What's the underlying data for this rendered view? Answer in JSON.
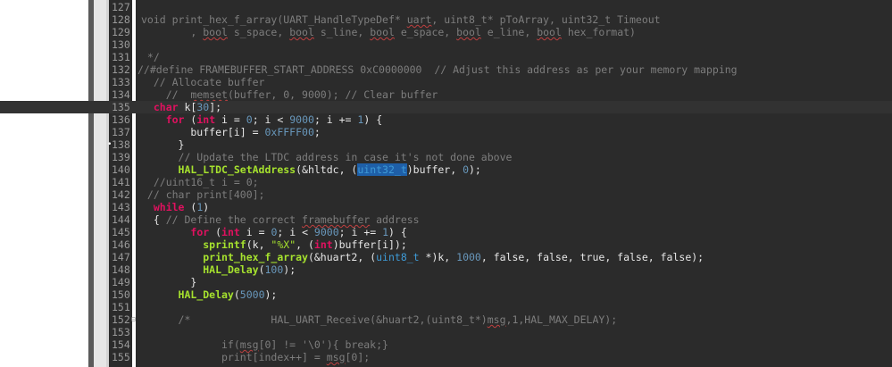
{
  "colors": {
    "editor_background": "#2b2b2b",
    "keyword": "#e0115f",
    "function": "#a6e22e",
    "comment": "#7d7d7d",
    "number": "#6897bb",
    "type": "#3e9ad6",
    "selection": "#1e5fa8",
    "line_number": "#9a9a9a"
  },
  "editor": {
    "lines": [
      {
        "num": "127",
        "tokens": []
      },
      {
        "num": "128",
        "tokens": [
          {
            "t": "void print_hex_f_array(UART_HandleTypeDef* ",
            "c": "comment"
          },
          {
            "t": "uart",
            "c": "spell"
          },
          {
            "t": ", uint8_t* pToArray, uint32_t Timeout",
            "c": "comment"
          }
        ]
      },
      {
        "num": "129",
        "tokens": [
          {
            "t": "        , ",
            "c": "comment"
          },
          {
            "t": "bool",
            "c": "spell"
          },
          {
            "t": " s_space, ",
            "c": "comment"
          },
          {
            "t": "bool",
            "c": "spell"
          },
          {
            "t": " s_line, ",
            "c": "comment"
          },
          {
            "t": "bool",
            "c": "spell"
          },
          {
            "t": " e_space, ",
            "c": "comment"
          },
          {
            "t": "bool",
            "c": "spell"
          },
          {
            "t": " e_line, ",
            "c": "comment"
          },
          {
            "t": "bool",
            "c": "spell"
          },
          {
            "t": " hex_format)",
            "c": "comment"
          }
        ]
      },
      {
        "num": "130",
        "tokens": []
      },
      {
        "num": "131",
        "tokens": [
          {
            "t": " */",
            "c": "comment"
          }
        ]
      },
      {
        "num": "132",
        "tokens": [
          {
            "t": "//#define FRAMEBUFFER_START_ADDRESS 0xC0000000  // Adjust this address as per your memory mapping",
            "c": "comment"
          }
        ],
        "shift": -4
      },
      {
        "num": "133",
        "tokens": [
          {
            "t": "  // Allocate buffer",
            "c": "comment"
          }
        ]
      },
      {
        "num": "134",
        "tokens": [
          {
            "t": "    //  ",
            "c": "comment"
          },
          {
            "t": "memset",
            "c": "spell"
          },
          {
            "t": "(buffer, 0, 9000); // Clear buffer",
            "c": "comment"
          }
        ]
      },
      {
        "num": "135",
        "current": true,
        "tokens": [
          {
            "t": "  ",
            "c": "default"
          },
          {
            "t": "char",
            "c": "kw"
          },
          {
            "t": " k[",
            "c": "default"
          },
          {
            "t": "30",
            "c": "num"
          },
          {
            "t": "];",
            "c": "default"
          }
        ]
      },
      {
        "num": "136",
        "tokens": [
          {
            "t": "    ",
            "c": "default"
          },
          {
            "t": "for",
            "c": "kw"
          },
          {
            "t": " (",
            "c": "default"
          },
          {
            "t": "int",
            "c": "kw"
          },
          {
            "t": " i = ",
            "c": "default"
          },
          {
            "t": "0",
            "c": "num"
          },
          {
            "t": "; i < ",
            "c": "default"
          },
          {
            "t": "9000",
            "c": "num"
          },
          {
            "t": "; i += ",
            "c": "default"
          },
          {
            "t": "1",
            "c": "num"
          },
          {
            "t": ") {",
            "c": "default"
          }
        ]
      },
      {
        "num": "137",
        "tokens": [
          {
            "t": "        buffer[i] = ",
            "c": "default"
          },
          {
            "t": "0xFFFF00",
            "c": "num"
          },
          {
            "t": ";",
            "c": "default"
          }
        ]
      },
      {
        "num": "138",
        "marker": true,
        "tokens": [
          {
            "t": "      }",
            "c": "default"
          }
        ]
      },
      {
        "num": "139",
        "tokens": [
          {
            "t": "      // Update the LTDC address in case it's not done above",
            "c": "comment"
          }
        ]
      },
      {
        "num": "140",
        "tokens": [
          {
            "t": "      ",
            "c": "default"
          },
          {
            "t": "HAL_LTDC_SetAddress",
            "c": "fn"
          },
          {
            "t": "(&hltdc, (",
            "c": "default"
          },
          {
            "t": "uint32_t",
            "c": "type-sel"
          },
          {
            "t": ")buffer, ",
            "c": "default"
          },
          {
            "t": "0",
            "c": "num"
          },
          {
            "t": ");",
            "c": "default"
          }
        ]
      },
      {
        "num": "141",
        "tokens": [
          {
            "t": "  //uint16_t i = 0;",
            "c": "comment"
          }
        ]
      },
      {
        "num": "142",
        "tokens": [
          {
            "t": " // char print[400];",
            "c": "comment"
          }
        ]
      },
      {
        "num": "143",
        "tokens": [
          {
            "t": "  ",
            "c": "default"
          },
          {
            "t": "while",
            "c": "kw"
          },
          {
            "t": " (",
            "c": "default"
          },
          {
            "t": "1",
            "c": "num"
          },
          {
            "t": ")",
            "c": "default"
          }
        ]
      },
      {
        "num": "144",
        "tokens": [
          {
            "t": "  { ",
            "c": "default"
          },
          {
            "t": "// Define the correct ",
            "c": "comment"
          },
          {
            "t": "framebuffer",
            "c": "spell"
          },
          {
            "t": " address",
            "c": "comment"
          }
        ]
      },
      {
        "num": "145",
        "tokens": [
          {
            "t": "        ",
            "c": "default"
          },
          {
            "t": "for",
            "c": "kw"
          },
          {
            "t": " (",
            "c": "default"
          },
          {
            "t": "int",
            "c": "kw"
          },
          {
            "t": " i = ",
            "c": "default"
          },
          {
            "t": "0",
            "c": "num"
          },
          {
            "t": "; i < ",
            "c": "default"
          },
          {
            "t": "9000",
            "c": "num"
          },
          {
            "t": "; i += ",
            "c": "default"
          },
          {
            "t": "1",
            "c": "num"
          },
          {
            "t": ") {",
            "c": "default"
          }
        ]
      },
      {
        "num": "146",
        "tokens": [
          {
            "t": "          ",
            "c": "default"
          },
          {
            "t": "sprintf",
            "c": "fn"
          },
          {
            "t": "(k, ",
            "c": "default"
          },
          {
            "t": "\"%X\"",
            "c": "str"
          },
          {
            "t": ", (",
            "c": "default"
          },
          {
            "t": "int",
            "c": "kw"
          },
          {
            "t": ")buffer[i]);",
            "c": "default"
          }
        ]
      },
      {
        "num": "147",
        "tokens": [
          {
            "t": "          ",
            "c": "default"
          },
          {
            "t": "print_hex_f_array",
            "c": "fn"
          },
          {
            "t": "(&huart2, (",
            "c": "default"
          },
          {
            "t": "uint8_t",
            "c": "type"
          },
          {
            "t": " *)k, ",
            "c": "default"
          },
          {
            "t": "1000",
            "c": "num"
          },
          {
            "t": ", false, false, true, false, false);",
            "c": "default"
          }
        ]
      },
      {
        "num": "148",
        "tokens": [
          {
            "t": "          ",
            "c": "default"
          },
          {
            "t": "HAL_Delay",
            "c": "fn"
          },
          {
            "t": "(",
            "c": "default"
          },
          {
            "t": "100",
            "c": "num"
          },
          {
            "t": ");",
            "c": "default"
          }
        ]
      },
      {
        "num": "149",
        "tokens": [
          {
            "t": "        }",
            "c": "default"
          }
        ]
      },
      {
        "num": "150",
        "tokens": [
          {
            "t": "      ",
            "c": "default"
          },
          {
            "t": "HAL_Delay",
            "c": "fn"
          },
          {
            "t": "(",
            "c": "default"
          },
          {
            "t": "5000",
            "c": "num"
          },
          {
            "t": ");",
            "c": "default"
          }
        ]
      },
      {
        "num": "151",
        "tokens": []
      },
      {
        "num": "152",
        "fold": true,
        "tokens": [
          {
            "t": "      /*             HAL_UART_Receive(&huart2,(uint8_t*)",
            "c": "comment"
          },
          {
            "t": "msg",
            "c": "spell"
          },
          {
            "t": ",1,HAL_MAX_DELAY);",
            "c": "comment"
          }
        ]
      },
      {
        "num": "153",
        "tokens": []
      },
      {
        "num": "154",
        "tokens": [
          {
            "t": "             if(",
            "c": "comment"
          },
          {
            "t": "msg",
            "c": "spell"
          },
          {
            "t": "[0] != '\\0'){ break;}",
            "c": "comment"
          }
        ]
      },
      {
        "num": "155",
        "tokens": [
          {
            "t": "             print[index++] = ",
            "c": "comment"
          },
          {
            "t": "msg",
            "c": "spell"
          },
          {
            "t": "[0];",
            "c": "comment"
          }
        ]
      }
    ]
  }
}
